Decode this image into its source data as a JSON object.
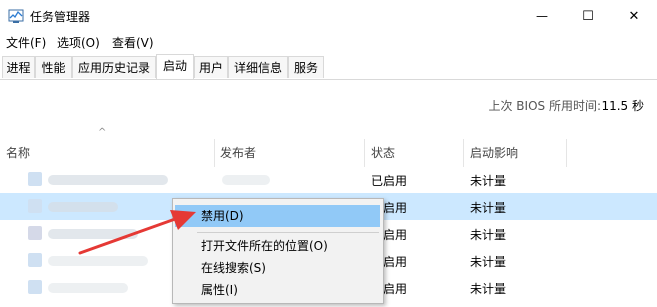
{
  "window": {
    "title": "任务管理器",
    "controls": [
      "—",
      "☐",
      "✕"
    ]
  },
  "menu": [
    "文件(F)",
    "选项(O)",
    "查看(V)"
  ],
  "tabs": [
    {
      "label": "进程",
      "active": false
    },
    {
      "label": "性能",
      "active": false
    },
    {
      "label": "应用历史记录",
      "active": false
    },
    {
      "label": "启动",
      "active": true
    },
    {
      "label": "用户",
      "active": false
    },
    {
      "label": "详细信息",
      "active": false
    },
    {
      "label": "服务",
      "active": false
    }
  ],
  "bios": {
    "label": "上次 BIOS 所用时间:",
    "value": "11.5 秒"
  },
  "columns": {
    "sort_caret": "^",
    "name": "名称",
    "publisher": "发布者",
    "status": "状态",
    "impact": "启动影响"
  },
  "rows": [
    {
      "status": "已启用",
      "impact": "未计量",
      "selected": false
    },
    {
      "status": "已启用",
      "impact": "未计量",
      "selected": true
    },
    {
      "status": "已启用",
      "impact": "未计量",
      "selected": false
    },
    {
      "status": "已启用",
      "impact": "未计量",
      "selected": false
    },
    {
      "status": "已启用",
      "impact": "未计量",
      "selected": false
    }
  ],
  "context_menu": {
    "disable": "禁用(D)",
    "open_location": "打开文件所在的位置(O)",
    "search_online": "在线搜索(S)",
    "properties": "属性(I)"
  },
  "colors": {
    "selection": "#cce8ff",
    "menu_hover": "#91c9f7",
    "annotation_arrow": "#e53935"
  },
  "icons": [
    "task-manager-icon",
    "minimize-icon",
    "maximize-icon",
    "close-icon",
    "red-arrow-annotation"
  ]
}
